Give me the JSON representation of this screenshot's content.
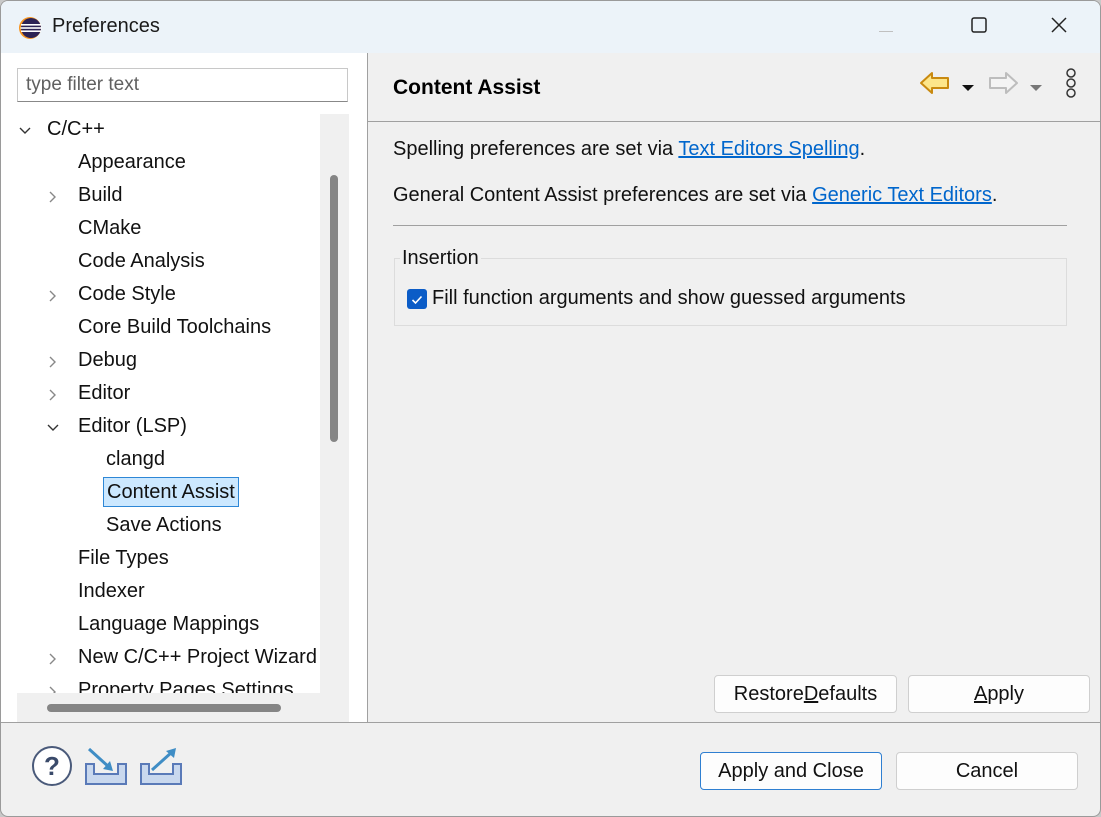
{
  "window": {
    "title": "Preferences",
    "controls": {
      "minimize": "minimize-icon",
      "maximize": "maximize-icon",
      "close": "close-icon"
    }
  },
  "sidebar": {
    "filter_placeholder": "type filter text",
    "filter_value": "",
    "tree": [
      {
        "label": "C/C++",
        "level": 0,
        "twisty": "expanded"
      },
      {
        "label": "Appearance",
        "level": 1,
        "twisty": "none"
      },
      {
        "label": "Build",
        "level": 1,
        "twisty": "collapsed"
      },
      {
        "label": "CMake",
        "level": 1,
        "twisty": "none"
      },
      {
        "label": "Code Analysis",
        "level": 1,
        "twisty": "none"
      },
      {
        "label": "Code Style",
        "level": 1,
        "twisty": "collapsed"
      },
      {
        "label": "Core Build Toolchains",
        "level": 1,
        "twisty": "none"
      },
      {
        "label": "Debug",
        "level": 1,
        "twisty": "collapsed"
      },
      {
        "label": "Editor",
        "level": 1,
        "twisty": "collapsed"
      },
      {
        "label": "Editor (LSP)",
        "level": 1,
        "twisty": "expanded"
      },
      {
        "label": "clangd",
        "level": 2,
        "twisty": "none"
      },
      {
        "label": "Content Assist",
        "level": 2,
        "twisty": "none",
        "selected": true
      },
      {
        "label": "Save Actions",
        "level": 2,
        "twisty": "none"
      },
      {
        "label": "File Types",
        "level": 1,
        "twisty": "none"
      },
      {
        "label": "Indexer",
        "level": 1,
        "twisty": "none"
      },
      {
        "label": "Language Mappings",
        "level": 1,
        "twisty": "none"
      },
      {
        "label": "New C/C++ Project Wizard",
        "level": 1,
        "twisty": "collapsed"
      },
      {
        "label": "Property Pages Settings",
        "level": 1,
        "twisty": "collapsed"
      }
    ]
  },
  "page": {
    "title": "Content Assist",
    "nav": {
      "back": "back-arrow-icon",
      "back_menu": "dropdown-icon",
      "forward": "forward-arrow-icon",
      "forward_menu": "dropdown-icon",
      "more": "more-vertical-icon"
    },
    "spelling_text": "Spelling preferences are set via ",
    "spelling_link": "Text Editors Spelling",
    "spelling_end": ".",
    "general_text": "General Content Assist preferences are set via ",
    "general_link": "Generic Text Editors",
    "general_end": ".",
    "insertion_group": {
      "label": "Insertion",
      "checkbox_label": "Fill function arguments and show guessed arguments",
      "checked": true
    },
    "restore_defaults": {
      "pre": "Restore ",
      "mnemonic": "D",
      "post": "efaults"
    },
    "apply": {
      "pre": "",
      "mnemonic": "A",
      "post": "pply"
    }
  },
  "footer": {
    "icons": [
      "help-icon",
      "import-icon",
      "export-icon"
    ],
    "apply_and_close": "Apply and Close",
    "cancel": "Cancel"
  },
  "colors": {
    "selection_bg": "#cce8ff",
    "selection_border": "#2e87d6",
    "link": "#0066cc",
    "checkbox": "#0b5cc7",
    "titlebar": "#ecf3f9"
  }
}
